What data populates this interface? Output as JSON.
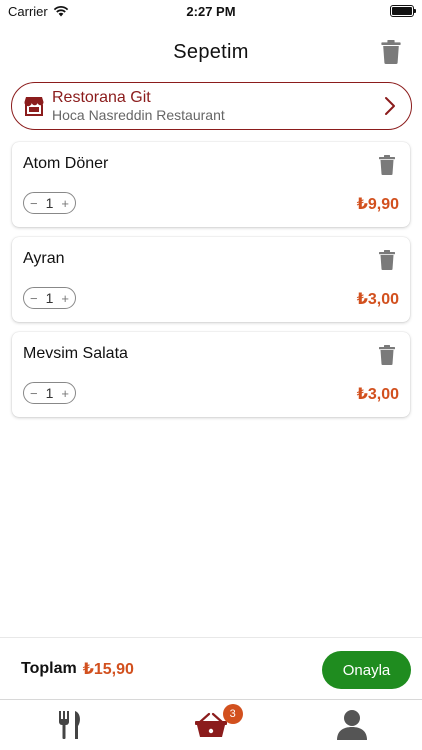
{
  "status_bar": {
    "carrier": "Carrier",
    "time": "2:27 PM"
  },
  "header": {
    "title": "Sepetim",
    "clear_icon": "trash-icon"
  },
  "restaurant": {
    "link_label": "Restorana Git",
    "name": "Hoca Nasreddin Restaurant",
    "icon": "store-icon",
    "chevron": "chevron-right-icon"
  },
  "cart": {
    "items": [
      {
        "name": "Atom Döner",
        "quantity": "1",
        "price": "₺9,90"
      },
      {
        "name": "Ayran",
        "quantity": "1",
        "price": "₺3,00"
      },
      {
        "name": "Mevsim Salata",
        "quantity": "1",
        "price": "₺3,00"
      }
    ],
    "decrement_symbol": "−",
    "increment_symbol": "+"
  },
  "footer": {
    "total_label": "Toplam",
    "total_value": "₺15,90",
    "confirm_label": "Onayla"
  },
  "tabs": {
    "items": [
      {
        "name": "menu",
        "icon": "fork-knife-icon"
      },
      {
        "name": "cart",
        "icon": "basket-icon",
        "badge": "3"
      },
      {
        "name": "profile",
        "icon": "user-icon"
      }
    ],
    "active": "cart"
  },
  "colors": {
    "brand": "#8b1c1c",
    "price": "#d2501e",
    "confirm": "#1f8c1f",
    "badge": "#d2501e"
  }
}
